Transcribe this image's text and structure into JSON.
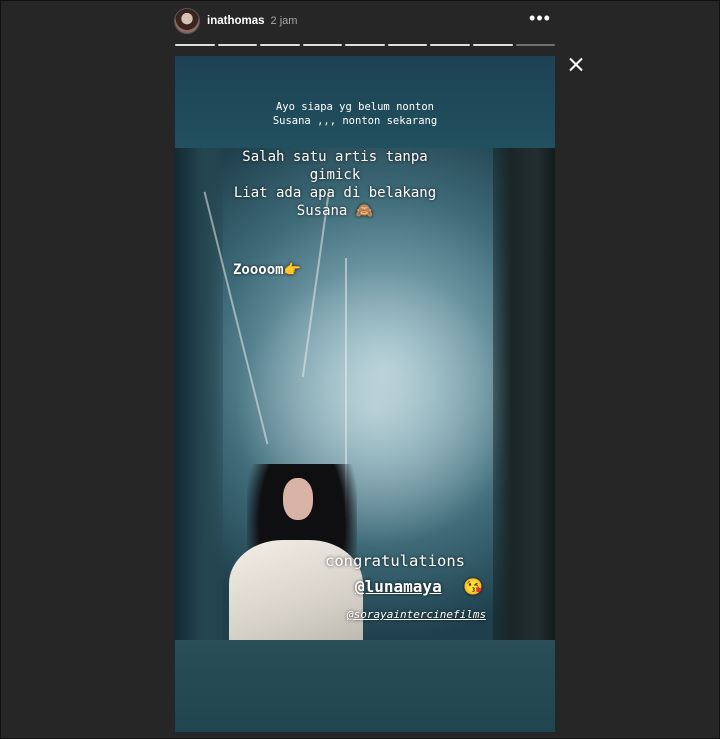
{
  "header": {
    "username": "inathomas",
    "time": "2 jam",
    "more_icon": "more-horizontal-icon",
    "more_glyph": "•••",
    "close_icon": "close-icon"
  },
  "progress": {
    "segments_total": 9,
    "segments_complete": 8
  },
  "story": {
    "top_caption_line1": "Ayo siapa yg belum nonton",
    "top_caption_line2": "Susana ,,, nonton sekarang",
    "overlay_line1": "Salah satu artis tanpa",
    "overlay_line2": "gimick",
    "overlay_line3": "Liat ada apa di belakang",
    "overlay_line4": "Susana 🙈",
    "zoom_text": "Zoooom👉",
    "congrats": "congratulations",
    "mention": "@lunamaya",
    "mention_emoji": "😘",
    "credit": "@sorayaintercinefilms"
  },
  "colors": {
    "background": "#262626",
    "story_band": "#1f4a57"
  }
}
